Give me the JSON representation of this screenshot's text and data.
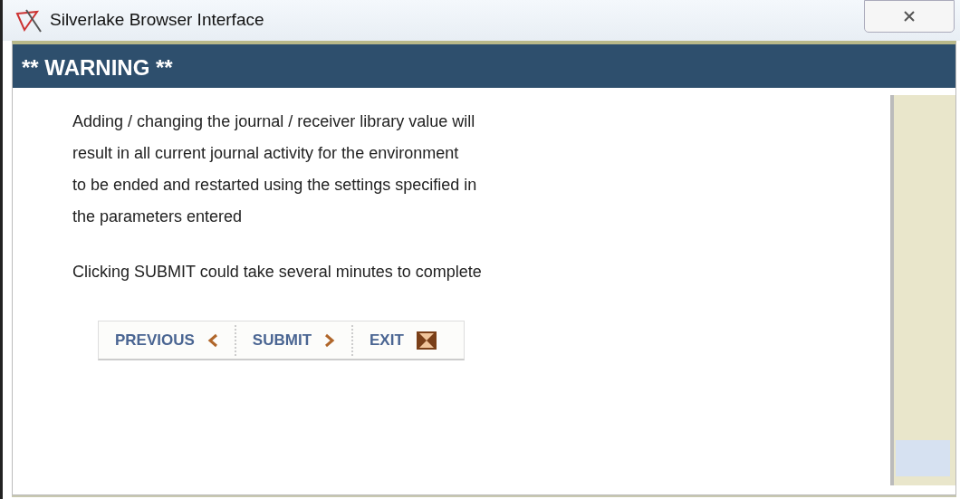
{
  "window": {
    "title": "Silverlake Browser Interface"
  },
  "header": {
    "title": "** WARNING **"
  },
  "message": {
    "paragraphs": [
      {
        "lines": [
          "Adding / changing the journal / receiver library value will",
          "result in all current journal activity for the environment",
          "to be ended and restarted using the settings specified in",
          "the parameters entered"
        ]
      },
      {
        "lines": [
          "Clicking SUBMIT could take several minutes to complete"
        ]
      }
    ]
  },
  "buttons": [
    {
      "label": "PREVIOUS",
      "kind": "back"
    },
    {
      "label": "SUBMIT",
      "kind": "next"
    },
    {
      "label": "EXIT",
      "kind": "exit"
    }
  ]
}
